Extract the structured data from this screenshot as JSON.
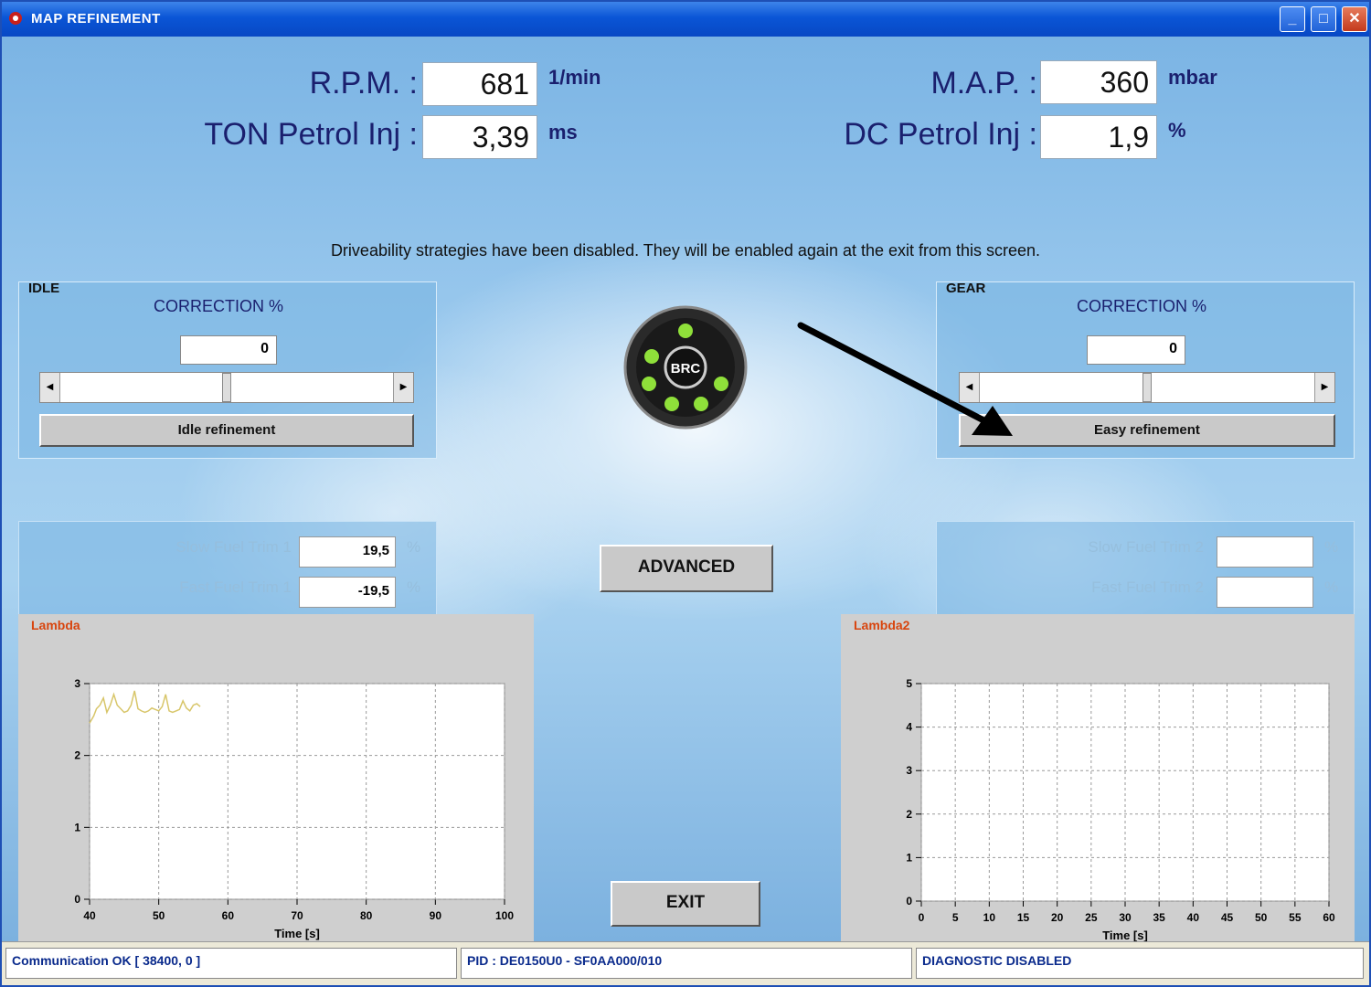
{
  "window": {
    "title": "MAP REFINEMENT",
    "controls": {
      "minimize": "_",
      "maximize": "□",
      "close": "✕"
    }
  },
  "readouts": {
    "rpm": {
      "label": "R.P.M. :",
      "value": "681",
      "unit": "1/min"
    },
    "ton": {
      "label": "TON Petrol Inj :",
      "value": "3,39",
      "unit": "ms"
    },
    "map": {
      "label": "M.A.P. :",
      "value": "360",
      "unit": "mbar"
    },
    "dc": {
      "label": "DC Petrol Inj :",
      "value": "1,9",
      "unit": "%"
    }
  },
  "notice": "Driveability strategies have been disabled. They will be enabled again at the exit from this screen.",
  "idle": {
    "group_label": "IDLE",
    "correction_label": "CORRECTION %",
    "correction_value": "0",
    "slider_position": 0.5,
    "button_label": "Idle refinement"
  },
  "gear": {
    "group_label": "GEAR",
    "correction_label": "CORRECTION %",
    "correction_value": "0",
    "slider_position": 0.5,
    "button_label": "Easy refinement"
  },
  "buttons": {
    "advanced": "ADVANCED",
    "exit": "EXIT"
  },
  "logo": {
    "text": "BRC"
  },
  "trim_left": {
    "slow_label": "Slow Fuel Trim 1",
    "slow_value": "19,5",
    "fast_label": "Fast Fuel Trim 1",
    "fast_value": "-19,5",
    "unit": "%"
  },
  "trim_right": {
    "slow_label": "Slow Fuel Trim 2",
    "slow_value": "",
    "fast_label": "Fast Fuel Trim 2",
    "fast_value": "",
    "unit": "%"
  },
  "chart_data": [
    {
      "type": "line",
      "title": "Lambda",
      "xlabel": "Time [s]",
      "ylabel": "",
      "xlim": [
        40,
        100
      ],
      "ylim": [
        0,
        3
      ],
      "x_ticks": [
        "40",
        "50",
        "60",
        "70",
        "80",
        "90",
        "100"
      ],
      "y_ticks": [
        "0",
        "1",
        "2",
        "3"
      ],
      "grid": true,
      "series": [
        {
          "color": "#d8c66a",
          "x": [
            40,
            40.3,
            40.6,
            41,
            41.5,
            42,
            42.5,
            43,
            43.5,
            44,
            44.5,
            45,
            45.5,
            46,
            46.5,
            47,
            47.5,
            48,
            48.5,
            49,
            49.5,
            50,
            50.5,
            51,
            51.5,
            52,
            52.5,
            53,
            53.5,
            54,
            54.5,
            55,
            55.5,
            56
          ],
          "y": [
            2.45,
            2.5,
            2.55,
            2.65,
            2.7,
            2.8,
            2.6,
            2.7,
            2.85,
            2.7,
            2.65,
            2.6,
            2.62,
            2.7,
            2.9,
            2.65,
            2.62,
            2.6,
            2.62,
            2.66,
            2.64,
            2.62,
            2.68,
            2.85,
            2.62,
            2.6,
            2.62,
            2.64,
            2.76,
            2.66,
            2.62,
            2.7,
            2.72,
            2.68
          ]
        }
      ]
    },
    {
      "type": "line",
      "title": "Lambda2",
      "xlabel": "Time [s]",
      "ylabel": "",
      "xlim": [
        0,
        60
      ],
      "ylim": [
        0,
        5
      ],
      "x_ticks": [
        "0",
        "5",
        "10",
        "15",
        "20",
        "25",
        "30",
        "35",
        "40",
        "45",
        "50",
        "55",
        "60"
      ],
      "y_ticks": [
        "0",
        "1",
        "2",
        "3",
        "4",
        "5"
      ],
      "grid": true,
      "series": []
    }
  ],
  "statusbar": {
    "communication": "Communication OK [ 38400, 0 ]",
    "pid": "PID : DE0150U0 - SF0AA000/010",
    "diagnostic": "DIAGNOSTIC DISABLED"
  }
}
